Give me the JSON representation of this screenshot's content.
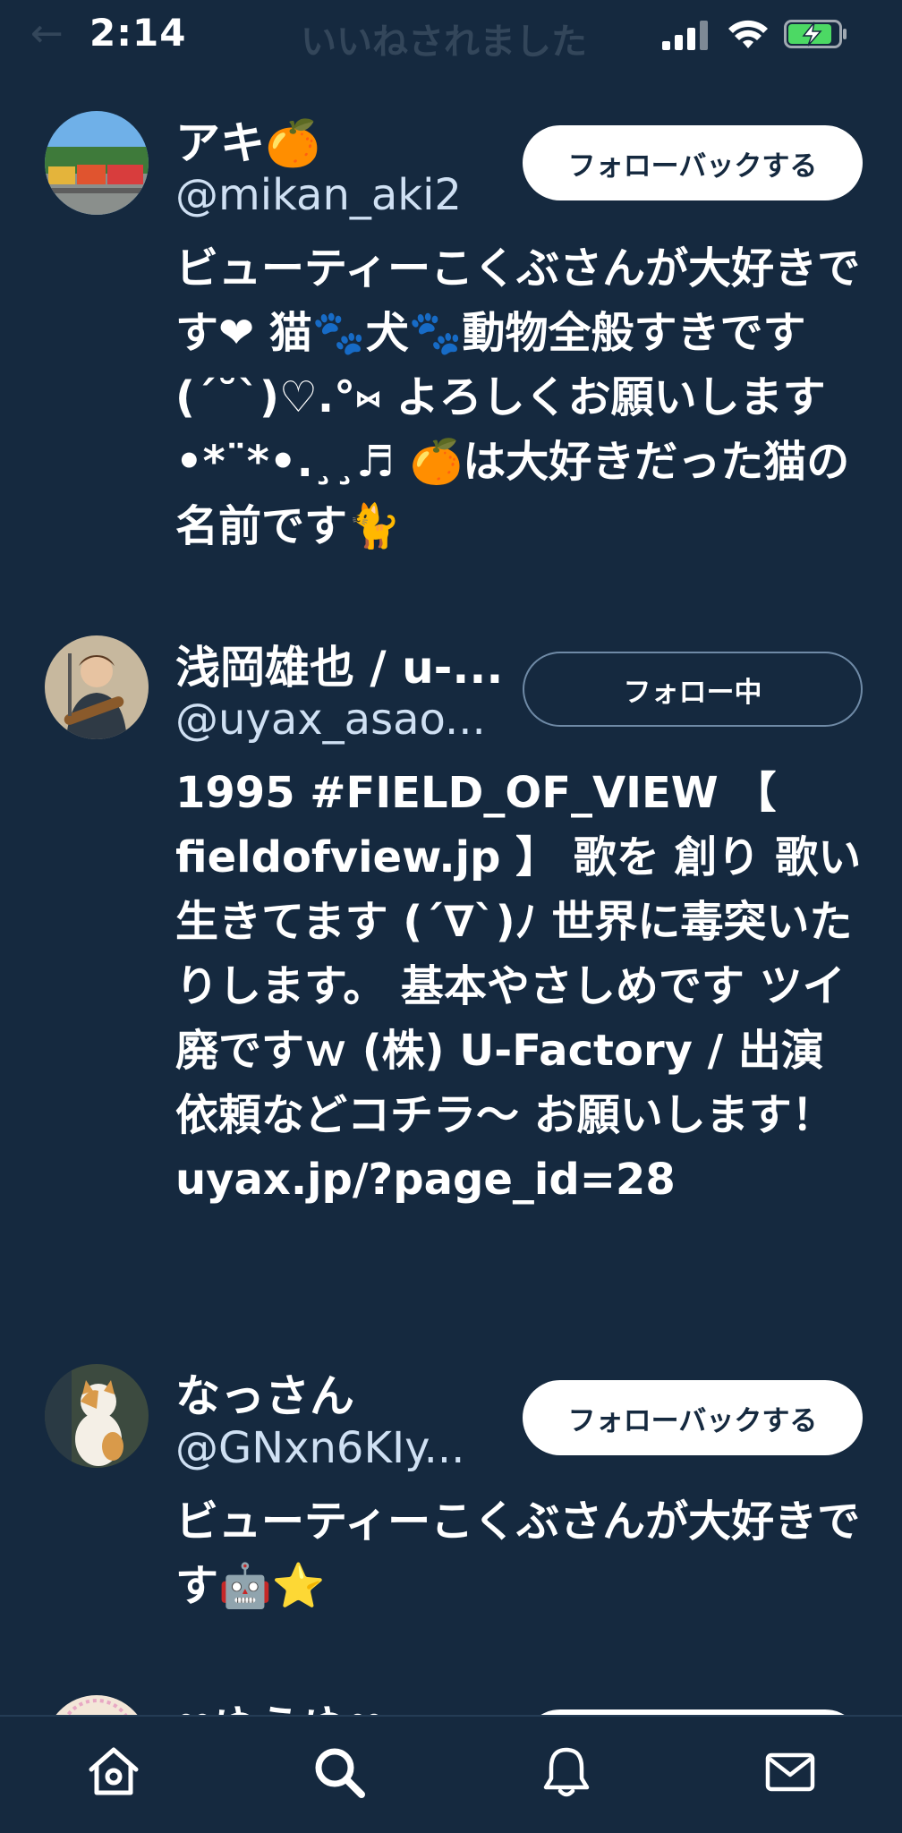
{
  "status_bar": {
    "time": "2:14",
    "nav_title": "いいねされました",
    "back_glyph": "←"
  },
  "users": [
    {
      "name": "アキ🍊",
      "handle": "@mikan_aki2",
      "button_label": "フォローバックする",
      "bio": "ビューティーこくぶさんが大好きです❤︎ 猫🐾犬🐾動物全般すきです(´˘`)♡.°⑅ よろしくお願いします•*¨*•.¸¸♬ 🍊は大好きだった猫の名前です🐈"
    },
    {
      "name": "浅岡雄也 / u-...",
      "handle": "@uyax_asao...",
      "button_label": "フォロー中",
      "bio": "1995 #FIELD_OF_VIEW 【 fieldofview.jp 】 歌を 創り 歌い 生きてます (´∇`)ﾉ 世界に毒突いたりします。 基本やさしめです ツイ廃ですｗ (株) U-Factory / 出演依頼などコチラ〜 お願いします！ uyax.jp/?page_id=28"
    },
    {
      "name": "なっさん",
      "handle": "@GNxn6KIy...",
      "button_label": "フォローバックする",
      "bio": "ビューティーこくぶさんが大好きです🤖⭐"
    },
    {
      "name": "❤ゆうゆ❤"
    }
  ],
  "tabs": [
    {
      "icon": "home-icon"
    },
    {
      "icon": "search-icon"
    },
    {
      "icon": "bell-icon"
    },
    {
      "icon": "mail-icon"
    }
  ],
  "colors": {
    "background": "#15293f",
    "text": "#ffffff",
    "handle": "#cfe0f3",
    "battery_charging": "#4cd964"
  }
}
